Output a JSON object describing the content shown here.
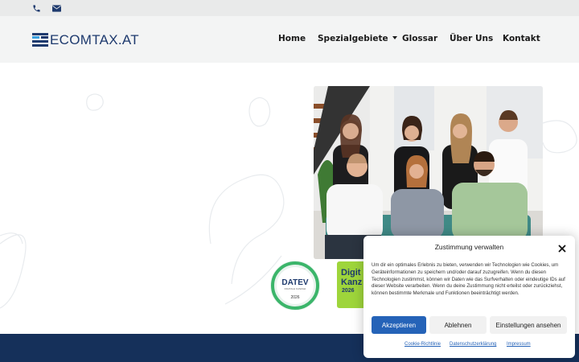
{
  "topbar": {
    "icons": [
      "phone-icon",
      "envelope-icon"
    ],
    "background": "#e9eaea"
  },
  "header": {
    "logo_text": "ECOMTAX.AT",
    "brand_color": "#1e3a6e",
    "nav": [
      {
        "label": "Home"
      },
      {
        "label": "Spezialgebiete",
        "dropdown": true
      },
      {
        "label": "Glossar"
      },
      {
        "label": "Über Uns"
      },
      {
        "label": "Kontakt"
      }
    ]
  },
  "hero": {
    "photo_icon": "team-photo",
    "badges": {
      "datev": {
        "brand": "DATEV",
        "subtitle": "DIGITALE KANZLEI",
        "year": "2026"
      },
      "digital": {
        "line1": "Digit",
        "line2": "Kanz",
        "year": "2026",
        "color": "#9ed53b"
      }
    }
  },
  "footer_band_color": "#15305a",
  "consent": {
    "title": "Zustimmung verwalten",
    "body": "Um dir ein optimales Erlebnis zu bieten, verwenden wir Technologien wie Cookies, um Geräteinformationen zu speichern und/oder darauf zuzugreifen. Wenn du diesen Technologien zustimmst, können wir Daten wie das Surfverhalten oder eindeutige IDs auf dieser Website verarbeiten. Wenn du deine Zustimmung nicht erteilst oder zurückziehst, können bestimmte Merkmale und Funktionen beeinträchtigt werden.",
    "buttons": {
      "accept": "Akzeptieren",
      "deny": "Ablehnen",
      "settings": "Einstellungen ansehen"
    },
    "links": [
      "Cookie-Richtlinie",
      "Datenschutzerklärung",
      "Impressum"
    ],
    "accent": "#2563b8"
  }
}
